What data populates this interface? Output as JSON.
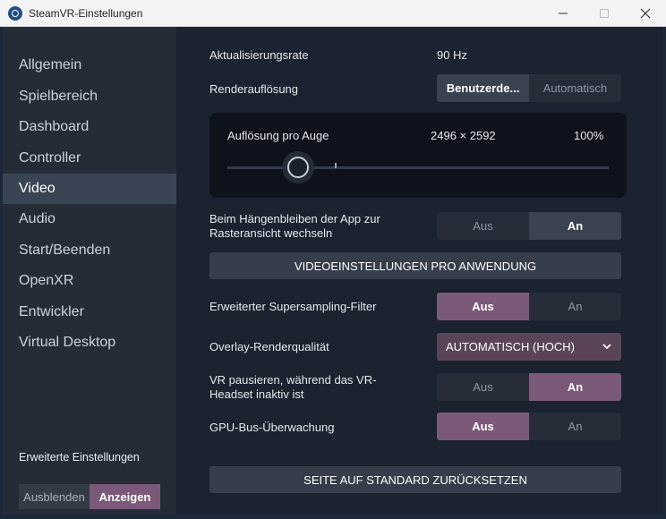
{
  "window": {
    "title": "SteamVR-Einstellungen"
  },
  "sidebar": {
    "items": [
      {
        "label": "Allgemein"
      },
      {
        "label": "Spielbereich"
      },
      {
        "label": "Dashboard"
      },
      {
        "label": "Controller"
      },
      {
        "label": "Video"
      },
      {
        "label": "Audio"
      },
      {
        "label": "Start/Beenden"
      },
      {
        "label": "OpenXR"
      },
      {
        "label": "Entwickler"
      },
      {
        "label": "Virtual Desktop"
      }
    ],
    "active_item": "Video",
    "advanced": {
      "label": "Erweiterte Einstellungen",
      "hide_label": "Ausblenden",
      "show_label": "Anzeigen",
      "selected": "Anzeigen"
    }
  },
  "settings": {
    "refresh_rate": {
      "label": "Aktualisierungsrate",
      "value": "90 Hz"
    },
    "render_resolution": {
      "label": "Renderauflösung",
      "custom_label": "Benutzerde...",
      "auto_label": "Automatisch",
      "selected": "Benutzerde..."
    },
    "per_eye": {
      "label": "Auflösung pro Auge",
      "resolution": "2496 × 2592",
      "percent": "100%",
      "slider_value": 0.2
    },
    "app_hang": {
      "label": "Beim Hängenbleiben der App zur Rasteransicht wechseln",
      "off_label": "Aus",
      "on_label": "An",
      "selected": "An"
    },
    "per_app_button": "VIDEOEINSTELLUNGEN PRO ANWENDUNG",
    "supersampling": {
      "label": "Erweiterter Supersampling-Filter",
      "off_label": "Aus",
      "on_label": "An",
      "selected": "Aus"
    },
    "overlay_quality": {
      "label": "Overlay-Renderqualität",
      "value": "AUTOMATISCH (HOCH)"
    },
    "pause_vr": {
      "label": "VR pausieren, während das VR-Headset inaktiv ist",
      "off_label": "Aus",
      "on_label": "An",
      "selected": "An"
    },
    "gpu_bus": {
      "label": "GPU-Bus-Überwachung",
      "off_label": "Aus",
      "on_label": "An",
      "selected": "Aus"
    },
    "reset_button": "SEITE AUF STANDARD ZURÜCKSETZEN"
  },
  "colors": {
    "accent": "#7a5a78",
    "dropdown": "#5a4558",
    "sidebar_bg": "#252c37",
    "main_bg": "#1b2230",
    "panel_bg": "#0e131b"
  },
  "icons": {
    "app": "steamvr-icon",
    "minimize": "minimize-icon",
    "maximize": "maximize-icon",
    "close": "close-icon",
    "dropdown": "chevron-down-icon"
  }
}
